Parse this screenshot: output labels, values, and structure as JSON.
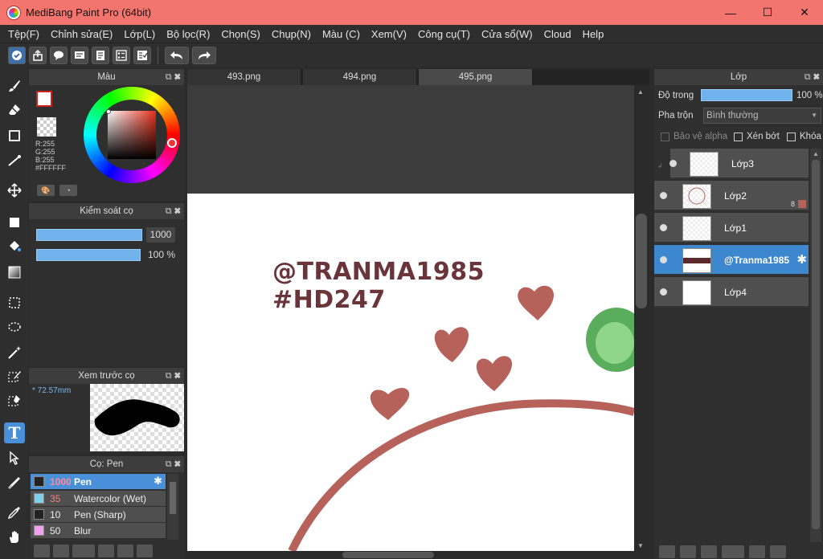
{
  "window": {
    "title": "MediBang Paint Pro (64bit)",
    "minimize": "—",
    "maximize": "☐",
    "close": "✕"
  },
  "menu": [
    "Tệp(F)",
    "Chỉnh sửa(E)",
    "Lớp(L)",
    "Bộ lọc(R)",
    "Chọn(S)",
    "Chụp(N)",
    "Màu (C)",
    "Xem(V)",
    "Công cụ(T)",
    "Cửa sổ(W)",
    "Cloud",
    "Help"
  ],
  "color_panel": {
    "title": "Màu",
    "r": "R:255",
    "g": "G:255",
    "b": "B:255",
    "hex": "#FFFFFF",
    "primary_color": "#ffffff",
    "border_color": "#cc2222"
  },
  "brush_control": {
    "title": "Kiểm soát cọ",
    "size_value": "1000",
    "opacity_value": "100 %"
  },
  "brush_preview": {
    "title": "Xem trước cọ",
    "size": "72.57mm"
  },
  "brush_list": {
    "title": "Cọ: Pen",
    "items": [
      {
        "size": "1000",
        "name": "Pen",
        "swatch": "#222222",
        "selected": true
      },
      {
        "size": "35",
        "name": "Watercolor (Wet)",
        "swatch": "#7fd0ea",
        "selected": false
      },
      {
        "size": "10",
        "name": "Pen (Sharp)",
        "swatch": "#222222",
        "selected": false
      },
      {
        "size": "50",
        "name": "Blur",
        "swatch": "#f3a0f0",
        "selected": false
      }
    ]
  },
  "tabs": [
    "493.png",
    "494.png",
    "495.png"
  ],
  "canvas": {
    "line1": "@TRANMA1985",
    "line2": "#HD247"
  },
  "layer_panel": {
    "title": "Lớp",
    "opacity_label": "Độ trong",
    "opacity_value": "100 %",
    "blend_label": "Pha trộn",
    "blend_value": "Bình thường",
    "protect_alpha": "Bảo vệ alpha",
    "clip": "Xén bớt",
    "lock": "Khóa",
    "layers": [
      {
        "name": "Lớp3",
        "selected": false
      },
      {
        "name": "Lớp2",
        "selected": false,
        "badge": "8"
      },
      {
        "name": "Lớp1",
        "selected": false
      },
      {
        "name": "@Tranma1985",
        "selected": true
      },
      {
        "name": "Lớp4",
        "selected": false
      }
    ]
  }
}
